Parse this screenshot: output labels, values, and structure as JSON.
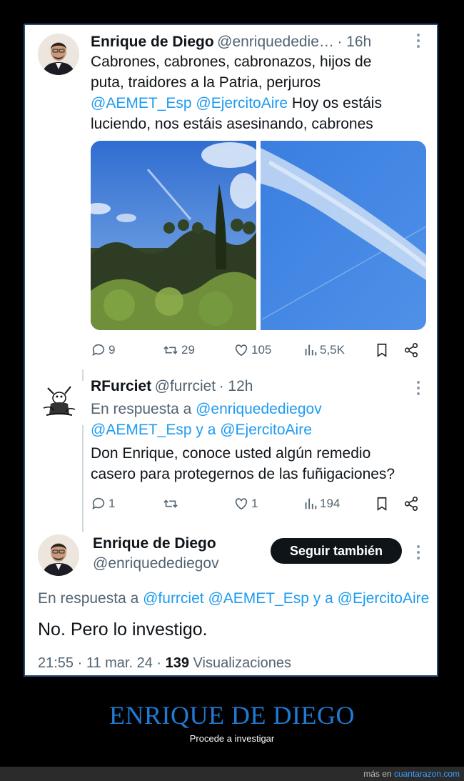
{
  "tweet1": {
    "name": "Enrique de Diego",
    "handle": "@enriquedediegov",
    "time": "· 16h",
    "text_line1": "Cabrones, cabrones, cabronazos, hijos de",
    "text_line2": "puta, traidores a la Patria, perjuros",
    "mention_aemet": "@AEMET_Esp",
    "mention_ejercito": "@EjercitoAire",
    "text_line3_rest": " Hoy os estáis",
    "text_line4": "luciendo, nos estáis asesinando, cabrones",
    "stats": {
      "replies": "9",
      "retweets": "29",
      "likes": "105",
      "views": "5,5K"
    }
  },
  "tweet2": {
    "name": "RFurciet",
    "handle": "@furrciet",
    "time": "· 12h",
    "reply_prefix": "En respuesta a",
    "reply_mention1": "@enriquedediegov",
    "reply_line2": "@AEMET_Esp y a @EjercitoAire",
    "text_line1": "Don Enrique, conoce usted algún remedio",
    "text_line2": "casero para protegernos de las fuñigaciones?",
    "stats": {
      "replies": "1",
      "retweets": "",
      "likes": "1",
      "views": "194"
    }
  },
  "tweet3": {
    "name": "Enrique de Diego",
    "handle": "@enriquedediegov",
    "follow_label": "Seguir también",
    "reply_prefix": "En respuesta a",
    "reply_mentions": "@furrciet @AEMET_Esp y a @EjercitoAire",
    "text": "No. Pero lo investigo.",
    "timestamp": "21:55 · 11 mar. 24 · ",
    "views_count": "139",
    "views_label": " Visualizaciones"
  },
  "caption": {
    "title": "ENRIQUE DE DIEGO",
    "subtitle": "Procede a investigar"
  },
  "footer": {
    "prefix": "más en ",
    "site": "cuantarazon.com"
  },
  "colors": {
    "link": "#1d9bf0",
    "caption": "#1f7bd3",
    "card_border": "#2b4a7a"
  }
}
